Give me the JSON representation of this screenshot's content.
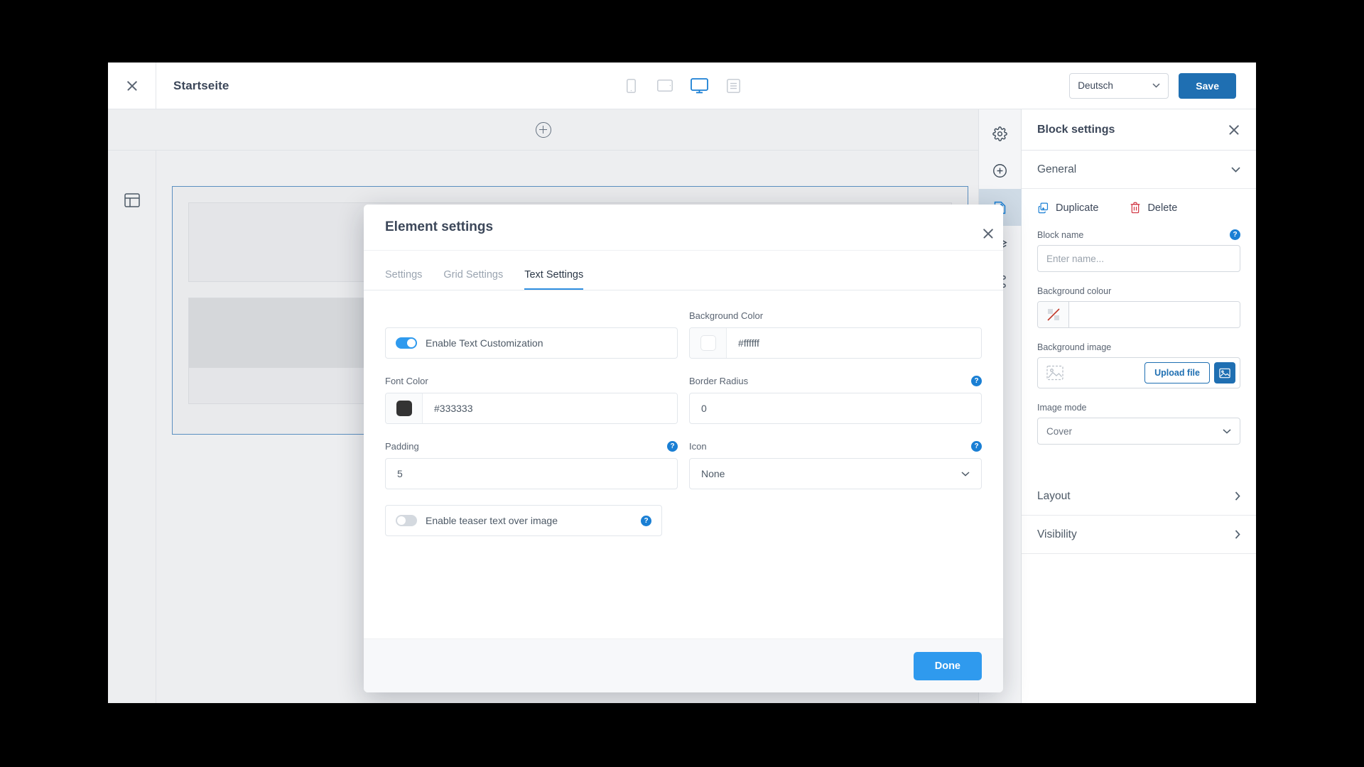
{
  "topbar": {
    "close_icon": "close-icon",
    "page_title": "Startseite",
    "devices": [
      {
        "name": "mobile",
        "icon": "mobile-icon",
        "active": false
      },
      {
        "name": "tablet",
        "icon": "tablet-icon",
        "active": false
      },
      {
        "name": "desktop",
        "icon": "desktop-icon",
        "active": true
      },
      {
        "name": "content",
        "icon": "list-icon",
        "active": false
      }
    ],
    "language": "Deutsch",
    "language_caret": "chevron-down-icon",
    "save_label": "Save",
    "save_color": "#1f6fb2"
  },
  "canvas": {
    "add_block_icon": "plus-circle-icon",
    "layout_icon": "layout-icon"
  },
  "icon_rail": [
    {
      "name": "gear-icon",
      "active": false
    },
    {
      "name": "plus-circle-icon",
      "active": false
    },
    {
      "name": "edit-document-icon",
      "active": true
    },
    {
      "name": "layers-icon",
      "active": false
    },
    {
      "name": "share-icon",
      "active": false
    }
  ],
  "panel": {
    "title": "Block settings",
    "close_icon": "close-icon",
    "sections": {
      "general": {
        "label": "General",
        "expanded": true,
        "caret": "chevron-down-icon"
      },
      "layout": {
        "label": "Layout",
        "expanded": false,
        "caret": "chevron-right-icon"
      },
      "visibility": {
        "label": "Visibility",
        "expanded": false,
        "caret": "chevron-right-icon"
      }
    },
    "actions": {
      "duplicate_label": "Duplicate",
      "duplicate_icon": "copy-icon",
      "duplicate_color": "#1a7fd4",
      "delete_label": "Delete",
      "delete_icon": "trash-icon",
      "delete_color": "#d0303e"
    },
    "block_name": {
      "label": "Block name",
      "help": "?",
      "value": "",
      "placeholder": "Enter name..."
    },
    "background_colour": {
      "label": "Background colour",
      "swatch_icon": "no-color-icon",
      "value": ""
    },
    "background_image": {
      "label": "Background image",
      "thumb_icon": "image-placeholder-icon",
      "upload_label": "Upload file",
      "library_icon": "image-library-icon"
    },
    "image_mode": {
      "label": "Image mode",
      "value": "Cover",
      "caret": "chevron-down-icon"
    }
  },
  "modal": {
    "title": "Element settings",
    "close_icon": "close-icon",
    "tabs": [
      {
        "label": "Settings",
        "active": false
      },
      {
        "label": "Grid Settings",
        "active": false
      },
      {
        "label": "Text Settings",
        "active": true
      }
    ],
    "fields": {
      "enable_text_customization": {
        "label": "Enable Text Customization",
        "enabled": true
      },
      "background_color": {
        "label": "Background Color",
        "value": "#ffffff",
        "swatch": "#ffffff"
      },
      "font_color": {
        "label": "Font Color",
        "value": "#333333",
        "swatch": "#333333"
      },
      "border_radius": {
        "label": "Border Radius",
        "value": "0",
        "help": "?"
      },
      "padding": {
        "label": "Padding",
        "value": "5",
        "help": "?"
      },
      "icon": {
        "label": "Icon",
        "value": "None",
        "help": "?",
        "caret": "chevron-down-icon"
      },
      "enable_teaser_text": {
        "label": "Enable teaser text over image",
        "enabled": false,
        "help": "?"
      }
    },
    "done_label": "Done",
    "done_color": "#2f9aee"
  }
}
